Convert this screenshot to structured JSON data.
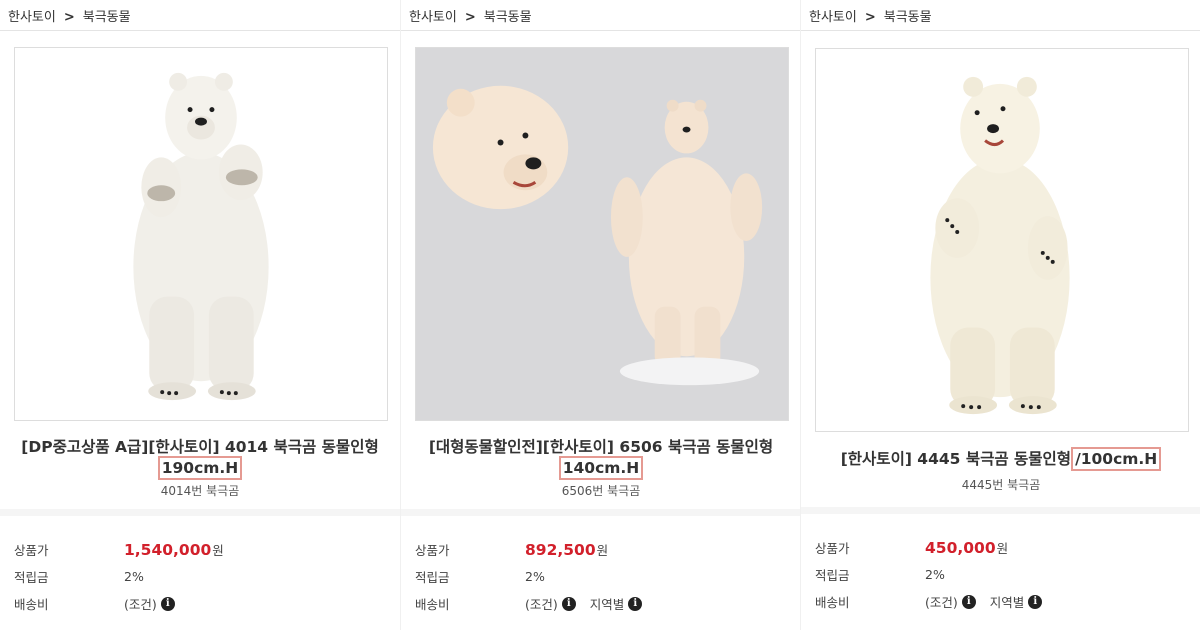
{
  "colors": {
    "price": "#d2202b",
    "highlight": "#e59a92"
  },
  "products": [
    {
      "breadcrumb": {
        "home": "한사토이",
        "sep": ">",
        "category": "북극동물"
      },
      "title_pre": "[DP중고상품 A급][한사토이] 4014 북극곰 동물인형",
      "title_hl": "190cm.H",
      "subtitle": "4014번 북극곰",
      "rows": {
        "price_label": "상품가",
        "price": "1,540,000",
        "currency": "원",
        "points_label": "적립금",
        "points": "2%",
        "ship_label": "배송비",
        "ship_cond": "(조건)",
        "ship_region": "",
        "info_icon": "info-icon"
      }
    },
    {
      "breadcrumb": {
        "home": "한사토이",
        "sep": ">",
        "category": "북극동물"
      },
      "title_pre": "[대형동물할인전][한사토이] 6506 북극곰 동물인형",
      "title_hl": "140cm.H",
      "subtitle": "6506번 북극곰",
      "rows": {
        "price_label": "상품가",
        "price": "892,500",
        "currency": "원",
        "points_label": "적립금",
        "points": "2%",
        "ship_label": "배송비",
        "ship_cond": "(조건)",
        "ship_region": "지역별",
        "info_icon": "info-icon"
      }
    },
    {
      "breadcrumb": {
        "home": "한사토이",
        "sep": ">",
        "category": "북극동물"
      },
      "title_pre": "[한사토이] 4445 북극곰 동물인형",
      "title_hl": "/100cm.H",
      "subtitle": "4445번 북극곰",
      "rows": {
        "price_label": "상품가",
        "price": "450,000",
        "currency": "원",
        "points_label": "적립금",
        "points": "2%",
        "ship_label": "배송비",
        "ship_cond": "(조건)",
        "ship_region": "지역별",
        "info_icon": "info-icon"
      }
    }
  ]
}
